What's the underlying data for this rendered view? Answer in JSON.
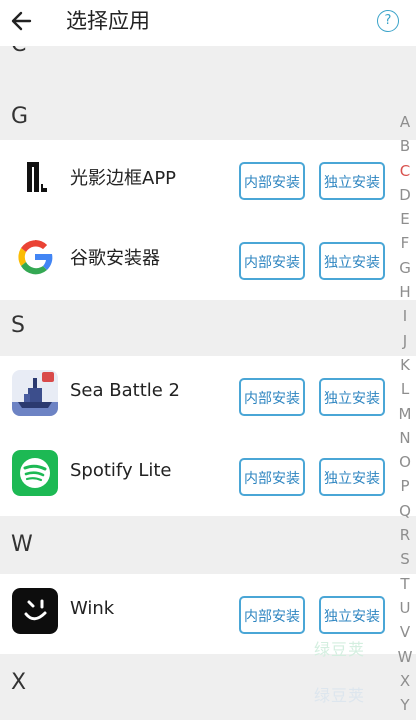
{
  "header": {
    "title": "选择应用",
    "help_symbol": "?"
  },
  "sections": [
    {
      "letter": "C"
    },
    {
      "letter": "G"
    },
    {
      "letter": "S"
    },
    {
      "letter": "W"
    },
    {
      "letter": "X"
    }
  ],
  "apps": [
    {
      "name": "光影边框APP",
      "icon": "light-frame-icon",
      "btn_internal": "内部安装",
      "btn_independent": "独立安装"
    },
    {
      "name": "谷歌安装器",
      "icon": "google-g-icon",
      "btn_internal": "内部安装",
      "btn_independent": "独立安装"
    },
    {
      "name": "Sea Battle 2",
      "icon": "battleship-icon",
      "btn_internal": "内部安装",
      "btn_independent": "独立安装"
    },
    {
      "name": "Spotify Lite",
      "icon": "spotify-icon",
      "btn_internal": "内部安装",
      "btn_independent": "独立安装"
    },
    {
      "name": "Wink",
      "icon": "wink-icon",
      "btn_internal": "内部安装",
      "btn_independent": "独立安装"
    }
  ],
  "alphabet_index": [
    "A",
    "B",
    "C",
    "D",
    "E",
    "F",
    "G",
    "H",
    "I",
    "J",
    "K",
    "L",
    "M",
    "N",
    "O",
    "P",
    "Q",
    "R",
    "S",
    "T",
    "U",
    "V",
    "W",
    "X",
    "Y"
  ],
  "active_index": "C",
  "watermark": [
    "绿豆荚",
    "绿豆荚"
  ],
  "colors": {
    "accent": "#4aa6d6",
    "active_letter": "#d9534f",
    "section_bg": "#efefef"
  }
}
